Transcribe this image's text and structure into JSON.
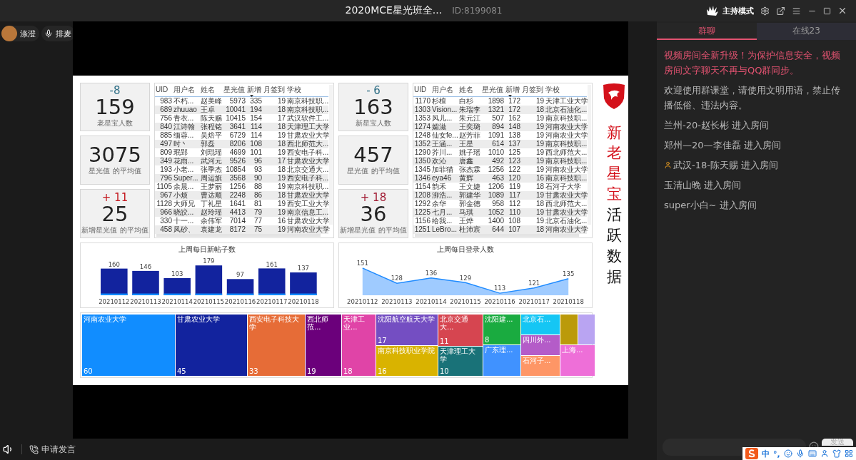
{
  "window": {
    "title": "2020MCE星光班全...",
    "room_id": "ID:8199081",
    "host_mode": "主持模式"
  },
  "users": {
    "name": "涤澄",
    "queue": "排麦"
  },
  "slide": {
    "left": {
      "kpis": [
        {
          "delta": "-8",
          "color": "#2f6f86",
          "value": "159",
          "label": "老星宝人数"
        },
        {
          "value": "3075",
          "label": "星光值 的平均值"
        },
        {
          "delta": "+ 11",
          "color": "#c4161c",
          "value": "25",
          "label": "新增星光值 的平均值"
        }
      ],
      "table": {
        "columns": [
          "UID",
          "用户名",
          "姓名",
          "星光值",
          "新增",
          "月签到",
          "学校"
        ],
        "rows": [
          [
            "983",
            "不朽...",
            "赵美峰",
            "5973",
            "335",
            "19",
            "南京科技职..."
          ],
          [
            "689",
            "zhuuao",
            "王卓",
            "10041",
            "194",
            "18",
            "南京科技职..."
          ],
          [
            "756",
            "青衣...",
            "陈天赐",
            "10415",
            "154",
            "17",
            "武汉软件工..."
          ],
          [
            "840",
            "江诗翰",
            "张程铭",
            "3641",
            "114",
            "18",
            "天津理工大学"
          ],
          [
            "885",
            "缅蓉...",
            "吴焙平",
            "6729",
            "114",
            "19",
            "甘肃农业大学"
          ],
          [
            "497",
            "时丶",
            "郭磊",
            "8206",
            "108",
            "18",
            "西北师范大..."
          ],
          [
            "809",
            "珉郢",
            "刘琨瑶",
            "4699",
            "101",
            "19",
            "西安电子科..."
          ],
          [
            "349",
            "花雨...",
            "武河元",
            "9526",
            "96",
            "17",
            "甘肃农业大学"
          ],
          [
            "193",
            "小老...",
            "张季杰",
            "10854",
            "93",
            "18",
            "北京交通大..."
          ],
          [
            "796",
            "Super...",
            "周运旗",
            "3568",
            "90",
            "19",
            "西安电子科..."
          ],
          [
            "1105",
            "余晨...",
            "王梦丽",
            "1256",
            "88",
            "19",
            "南京科技职..."
          ],
          [
            "967",
            "小烦",
            "曹达顺",
            "2248",
            "86",
            "18",
            "甘肃农业大学"
          ],
          [
            "1128",
            "大师兄",
            "丁礼星",
            "1641",
            "81",
            "19",
            "西安工业大学"
          ],
          [
            "966",
            "晓皎...",
            "赵玲瑶",
            "4413",
            "79",
            "19",
            "南京信息工..."
          ],
          [
            "330",
            "十一...",
            "余伟军",
            "7014",
            "77",
            "16",
            "甘肃农业大学"
          ],
          [
            "458",
            "凤砂、",
            "袁建龙",
            "8172",
            "75",
            "19",
            "河南农业大学"
          ]
        ]
      }
    },
    "right": {
      "kpis": [
        {
          "delta": "- 6",
          "color": "#2f6f86",
          "value": "163",
          "label": "新星宝人数"
        },
        {
          "value": "457",
          "label": "星光值 的平均值"
        },
        {
          "delta": "+ 18",
          "color": "#a01830",
          "value": "36",
          "label": "新增星光值 的平均值"
        }
      ],
      "table": {
        "columns": [
          "UID",
          "用户名",
          "姓名",
          "星光值",
          "新增",
          "月签到",
          "学校"
        ],
        "rows": [
          [
            "1170",
            "杉檀",
            "白杉",
            "1898",
            "172",
            "19",
            "天津工业大学"
          ],
          [
            "1303",
            "Vision...",
            "朱瑞李",
            "1321",
            "172",
            "18",
            "北京石油化..."
          ],
          [
            "1353",
            "风儿...",
            "朱元江",
            "507",
            "162",
            "19",
            "南京科技职..."
          ],
          [
            "1274",
            "孀滋",
            "王奕璐",
            "894",
            "148",
            "19",
            "河南农业大学"
          ],
          [
            "1248",
            "仙女fe...",
            "赵芳菲",
            "1091",
            "138",
            "19",
            "河南农业大学"
          ],
          [
            "1352",
            "王涵...",
            "王星",
            "614",
            "137",
            "19",
            "南京科技职..."
          ],
          [
            "1290",
            "芥川...",
            "姚子瑶",
            "1010",
            "125",
            "19",
            "西北师范大..."
          ],
          [
            "1350",
            "欢沁",
            "唐鑫",
            "492",
            "123",
            "19",
            "南京科技职..."
          ],
          [
            "1345",
            "加菲猫",
            "张杰霖",
            "1256",
            "122",
            "19",
            "河南农业大学"
          ],
          [
            "1346",
            "eya46",
            "黄辉",
            "463",
            "120",
            "16",
            "南京科技职..."
          ],
          [
            "1154",
            "韵禾",
            "王文婕",
            "1206",
            "119",
            "18",
            "石河子大学"
          ],
          [
            "1208",
            "泖浩...",
            "郭建华",
            "1089",
            "117",
            "19",
            "甘肃农业大学"
          ],
          [
            "1292",
            "余华",
            "郭金德",
            "958",
            "112",
            "18",
            "西北师范大..."
          ],
          [
            "1225",
            "七月...",
            "马琪",
            "1052",
            "110",
            "19",
            "甘肃农业大学"
          ],
          [
            "1156",
            "给我...",
            "王烨",
            "1400",
            "108",
            "19",
            "北京石油化..."
          ],
          [
            "1251",
            "LeBro...",
            "杜沛宸",
            "644",
            "107",
            "18",
            "河南农业大学"
          ]
        ]
      }
    },
    "title_red": "新老星宝",
    "title_black": "活跃数据",
    "bar_chart": {
      "chart_data": {
        "type": "bar",
        "title": "上周每日新帖子数",
        "categories": [
          "20210112",
          "20210113",
          "20210114",
          "20210115",
          "20210116",
          "20210117",
          "20210118"
        ],
        "series": [
          {
            "color": "#12239e",
            "values": [
              160,
              146,
              103,
              179,
              97,
              161,
              137
            ]
          }
        ],
        "data_labels": true
      }
    },
    "area_chart": {
      "chart_data": {
        "type": "area",
        "title": "上周每日登录人数",
        "categories": [
          "20210112",
          "20210113",
          "20210114",
          "20210115",
          "20210116",
          "20210117",
          "20210118"
        ],
        "series": [
          {
            "color": "#1f8bff",
            "values": [
              151,
              128,
              136,
              129,
              113,
              121,
              135
            ]
          }
        ],
        "data_labels": true
      }
    },
    "treemap": [
      {
        "label": "河南农业大学",
        "value": "60",
        "color": "#118dff"
      },
      {
        "label": "甘肃农业大学",
        "value": "45",
        "color": "#12239e"
      },
      {
        "label": "西安电子科技大学",
        "value": "33",
        "color": "#e66c37"
      },
      {
        "label": "西北师范...",
        "value": "19",
        "color": "#6b007b"
      },
      {
        "label": "天津工业...",
        "value": "18",
        "color": "#e044a7"
      },
      {
        "label": "沈阳航空航天大学",
        "value": "17",
        "color": "#744ec2"
      },
      {
        "label": "南京科技职业学院",
        "value": "16",
        "color": "#d9b300"
      },
      {
        "label": "北京交通大...",
        "value": "11",
        "color": "#d64550"
      },
      {
        "label": "天津理工大学",
        "value": "10",
        "color": "#197278"
      },
      {
        "label": "沈阳建...",
        "value": "8",
        "color": "#1aab40"
      },
      {
        "label": "广东理...",
        "color": "#4092ff"
      },
      {
        "label": "北京石...",
        "color": "#15c6f4"
      },
      {
        "label": "四川外...",
        "color": "#b45cc8"
      },
      {
        "label": "石河子...",
        "color": "#fe9666"
      },
      {
        "color": "#bb9a0a"
      },
      {
        "color": "#b9a4f2"
      },
      {
        "label": "上海...",
        "color": "#ee6fd8"
      }
    ]
  },
  "chat": {
    "tabs": [
      {
        "label": "群聊",
        "selected": true
      },
      {
        "label": "在线23",
        "selected": false
      }
    ],
    "messages": [
      {
        "kind": "notice",
        "badge": false,
        "text": "视频房间全新升级！为保护信息安全，视频房间文字聊天不再与QQ群同步。"
      },
      {
        "kind": "text",
        "badge": false,
        "text": "欢迎使用群课堂，请使用文明用语，禁止传播低俗、违法内容。"
      },
      {
        "kind": "text",
        "badge": false,
        "text": "兰州-20-赵长彬 进入房间"
      },
      {
        "kind": "text",
        "badge": false,
        "text": "郑州—20—李佳磊 进入房间"
      },
      {
        "kind": "text",
        "badge": true,
        "text": "武汉-18-陈天赐 进入房间"
      },
      {
        "kind": "text",
        "badge": false,
        "text": "玉清山晚 进入房间"
      },
      {
        "kind": "text",
        "badge": false,
        "text": "super小白~ 进入房间"
      }
    ],
    "send": "发送"
  },
  "bottom": {
    "request": "申请发言"
  },
  "ime": {
    "mode": "中",
    "punct": "°,"
  }
}
